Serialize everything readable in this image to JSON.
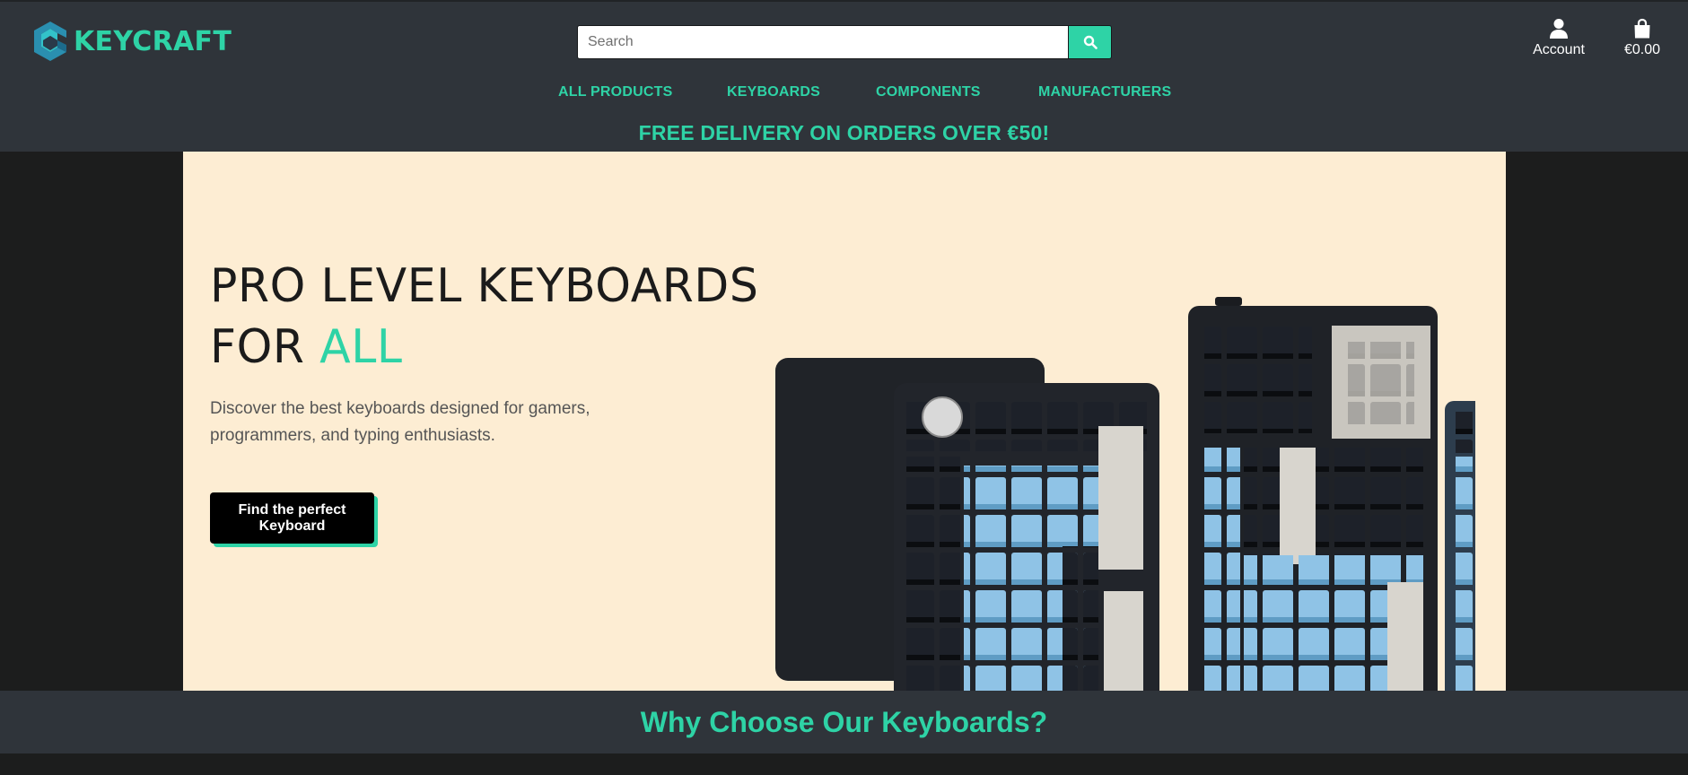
{
  "brand": {
    "name": "KEYCRAFT",
    "accent_color": "#2ed3a6",
    "header_bg": "#2f343a"
  },
  "search": {
    "placeholder": "Search",
    "value": "",
    "button_icon": "search-icon"
  },
  "header": {
    "account_label": "Account",
    "cart_total": "€0.00"
  },
  "nav": {
    "items": [
      "ALL PRODUCTS",
      "KEYBOARDS",
      "COMPONENTS",
      "MANUFACTURERS"
    ]
  },
  "promo": {
    "text": "FREE DELIVERY ON ORDERS OVER €50!"
  },
  "hero": {
    "title_line1": "PRO LEVEL KEYBOARDS",
    "title_line2_prefix": "FOR ",
    "title_line2_accent": "ALL",
    "subtitle": "Discover the best keyboards designed for gamers, programmers, and typing enthusiasts.",
    "cta_label": "Find the perfect Keyboard",
    "bg_color": "#fdedd3"
  },
  "section": {
    "why_title": "Why Choose Our Keyboards?"
  }
}
